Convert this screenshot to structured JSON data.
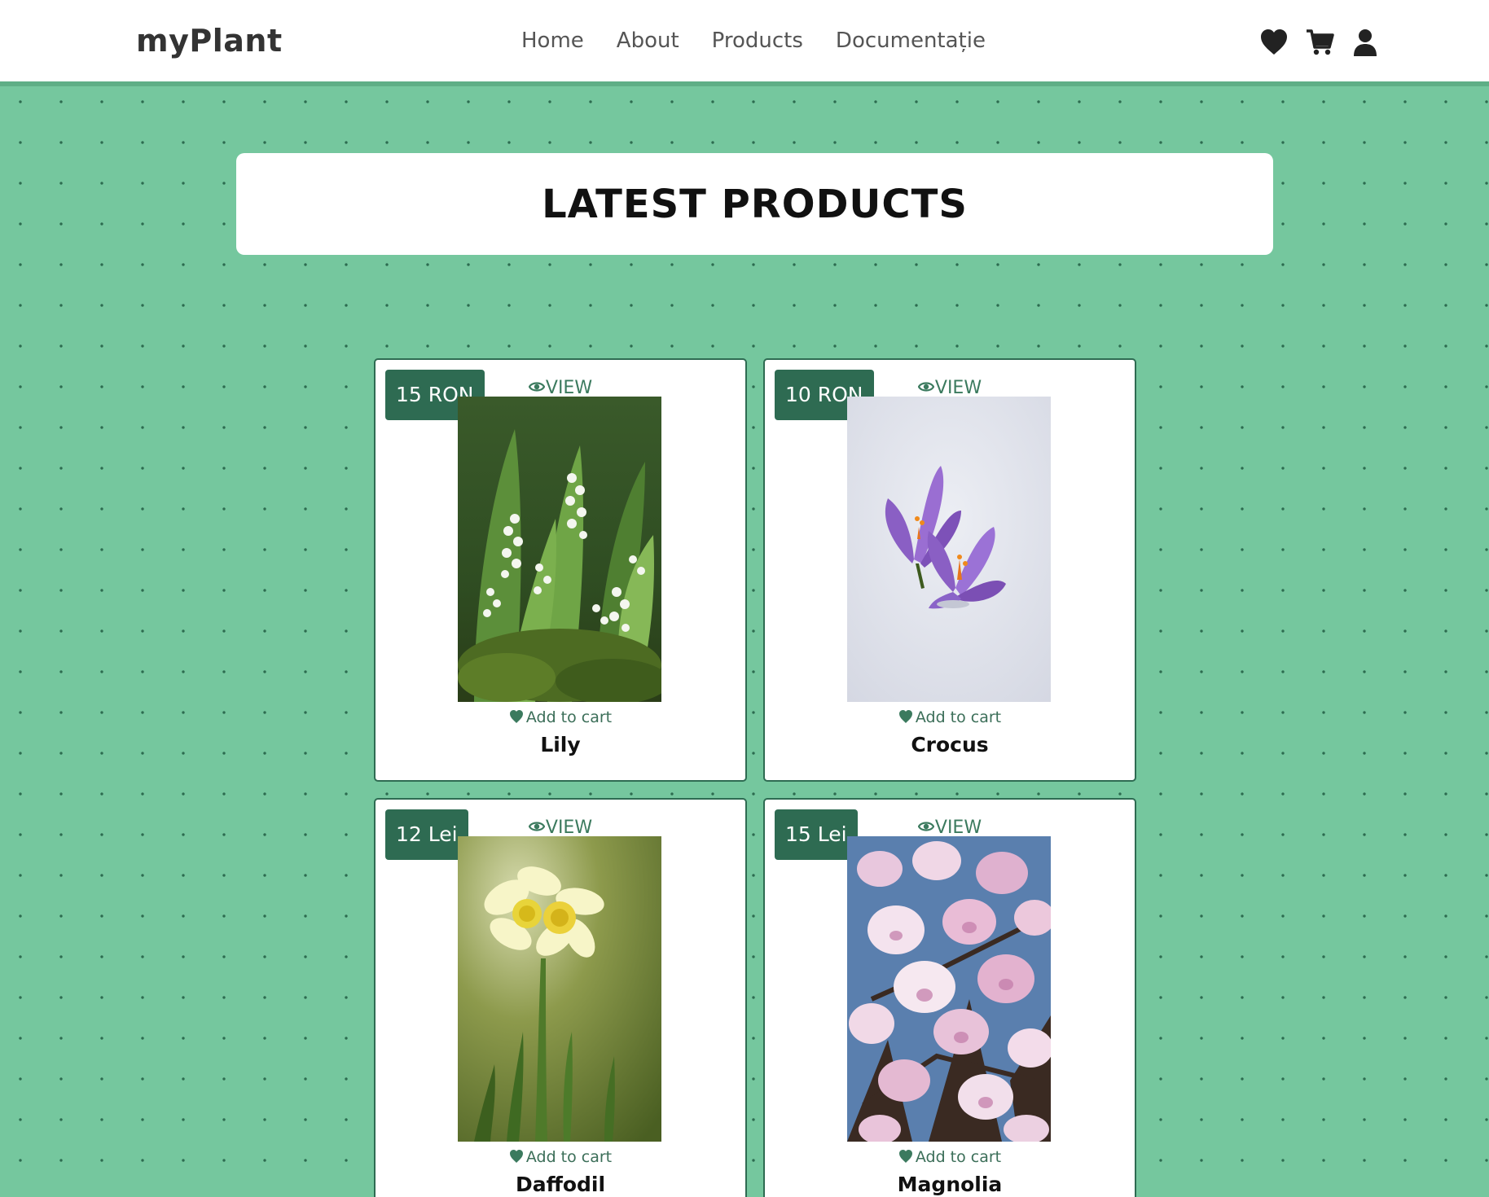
{
  "navbar": {
    "brand": "myPlant",
    "links": [
      "Home",
      "About",
      "Products",
      "Documentație"
    ],
    "icons": [
      "heart-icon",
      "cart-icon",
      "user-icon"
    ]
  },
  "heading": "LATEST PRODUCTS",
  "product_actions": {
    "view_label": "VIEW",
    "add_to_cart_label": "Add to cart"
  },
  "products": [
    {
      "name": "Lily",
      "price": "15 RON"
    },
    {
      "name": "Crocus",
      "price": "10 RON"
    },
    {
      "name": "Daffodil",
      "price": "12 Lei"
    },
    {
      "name": "Magnolia",
      "price": "15 Lei"
    }
  ],
  "colors": {
    "background": "#75c79e",
    "dots": "#2c6b4f",
    "accent": "#2e6b52",
    "navbar": "#ffffff",
    "navbar_border": "#5fae86"
  }
}
